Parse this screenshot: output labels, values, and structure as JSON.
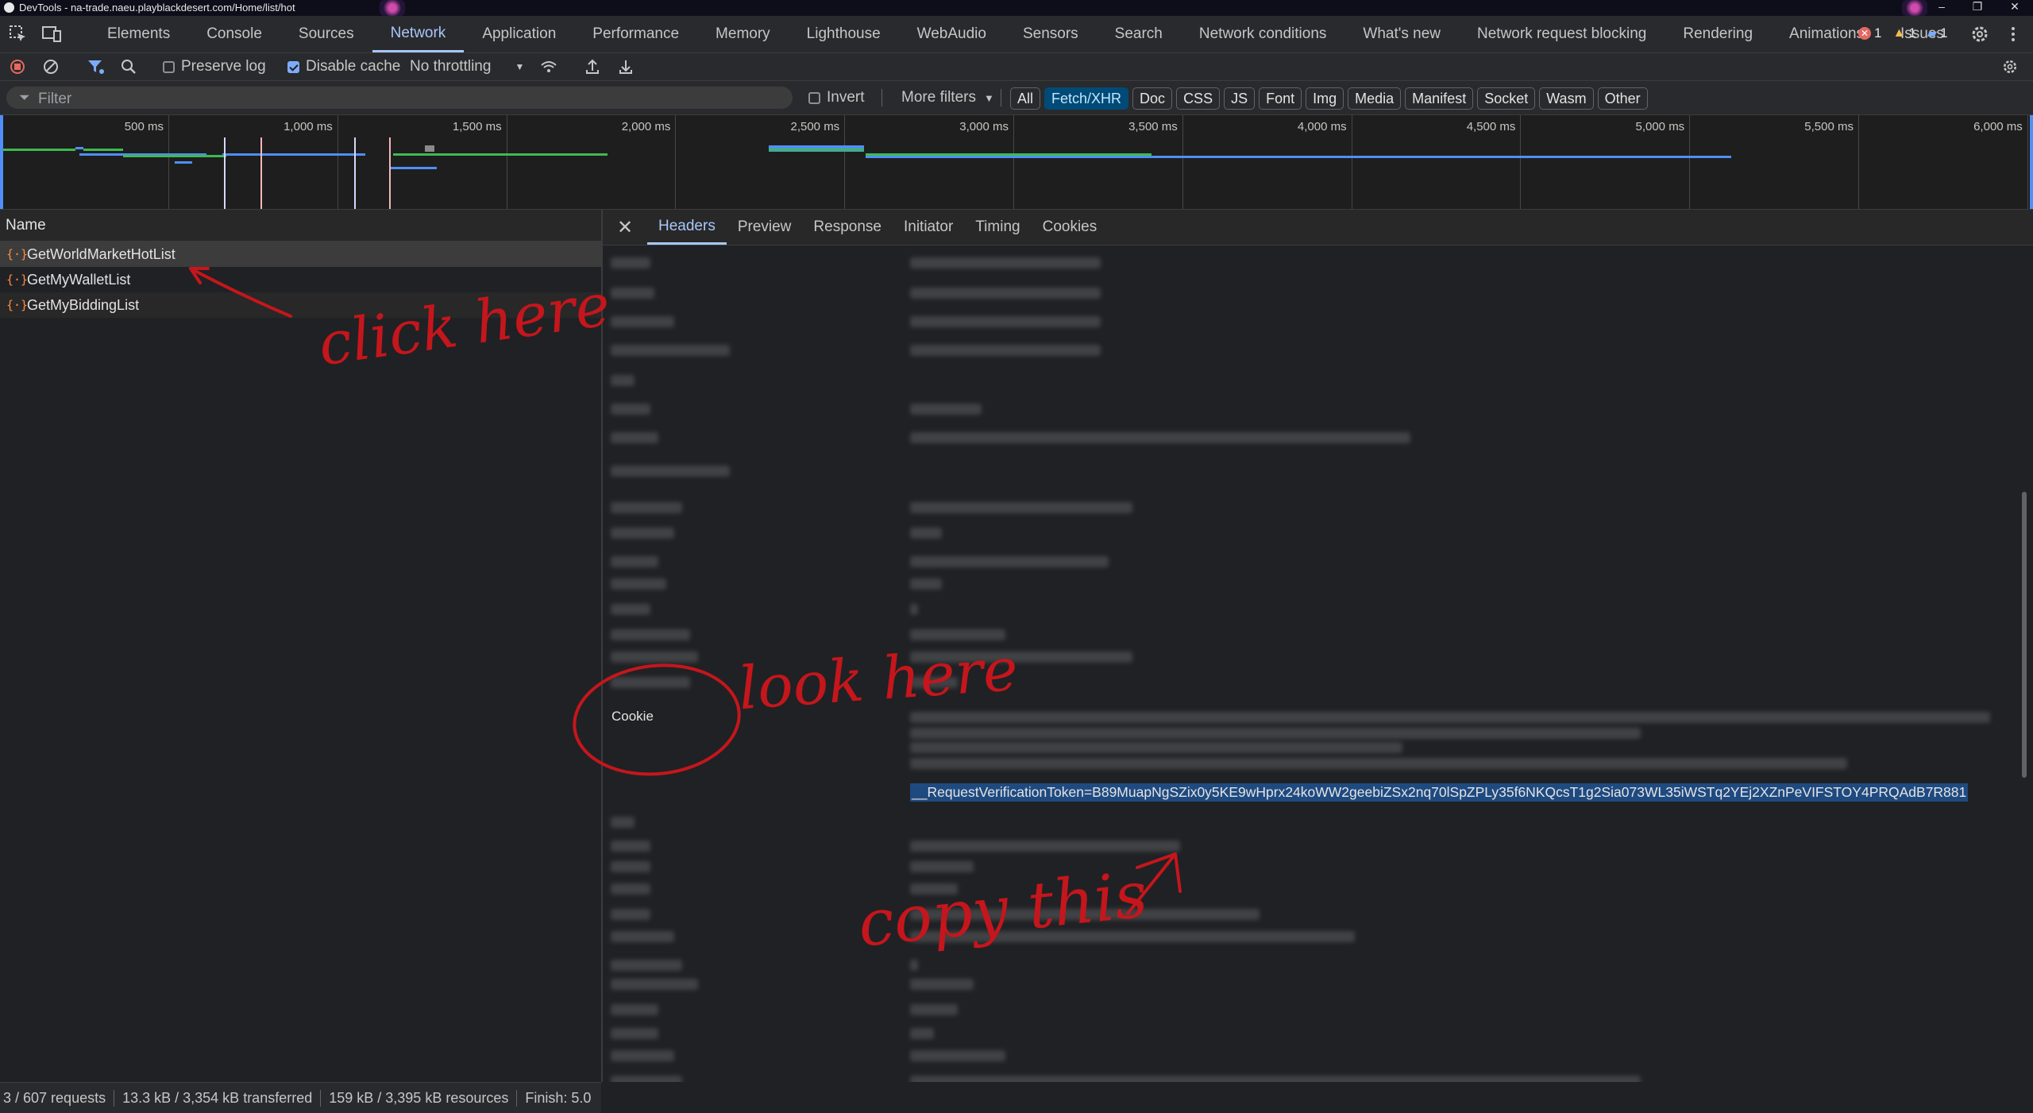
{
  "window": {
    "title": "DevTools - na-trade.naeu.playblackdesert.com/Home/list/hot"
  },
  "main_tabs": [
    "Elements",
    "Console",
    "Sources",
    "Network",
    "Application",
    "Performance",
    "Memory",
    "Lighthouse",
    "WebAudio",
    "Sensors",
    "Search",
    "Network conditions",
    "What's new",
    "Network request blocking",
    "Rendering",
    "Animations",
    "Issues"
  ],
  "active_tab": "Network",
  "counters": {
    "errors": "1",
    "warnings": "1",
    "messages": "1"
  },
  "toolbar": {
    "preserve_log": "Preserve log",
    "disable_cache": "Disable cache",
    "throttling": "No throttling"
  },
  "filterbar": {
    "placeholder": "Filter",
    "invert": "Invert",
    "more_filters": "More filters",
    "types": [
      "All",
      "Fetch/XHR",
      "Doc",
      "CSS",
      "JS",
      "Font",
      "Img",
      "Media",
      "Manifest",
      "Socket",
      "Wasm",
      "Other"
    ],
    "active_type": "Fetch/XHR"
  },
  "overview": {
    "ticks": [
      "500 ms",
      "1,000 ms",
      "1,500 ms",
      "2,000 ms",
      "2,500 ms",
      "3,000 ms",
      "3,500 ms",
      "4,000 ms",
      "4,500 ms",
      "5,000 ms",
      "5,500 ms",
      "6,000 ms"
    ]
  },
  "requests": {
    "header": "Name",
    "items": [
      "GetWorldMarketHotList",
      "GetMyWalletList",
      "GetMyBiddingList"
    ]
  },
  "detail": {
    "tabs": [
      "Headers",
      "Preview",
      "Response",
      "Initiator",
      "Timing",
      "Cookies"
    ],
    "active_tab": "Headers",
    "cookie_label": "Cookie",
    "token": "__RequestVerificationToken=B89MuapNgSZix0y5KE9wHprx24koWW2geebiZSx2nq70lSpZPLy35f6NKQcsT1g2Sia073WL35iWSTq2YEj2XZnPeVIFSTOY4PRQAdB7R881"
  },
  "status": {
    "requests": "3 / 607 requests",
    "transferred": "13.3 kB / 3,354 kB transferred",
    "resources": "159 kB / 3,395 kB resources",
    "finish": "Finish: 5.0"
  },
  "annotations": {
    "click": "click here",
    "look": "look here",
    "copy": "copy this"
  },
  "colors": {
    "accent": "#a8c7fa",
    "annotation": "#c4161c",
    "selection": "#1f4a80"
  }
}
